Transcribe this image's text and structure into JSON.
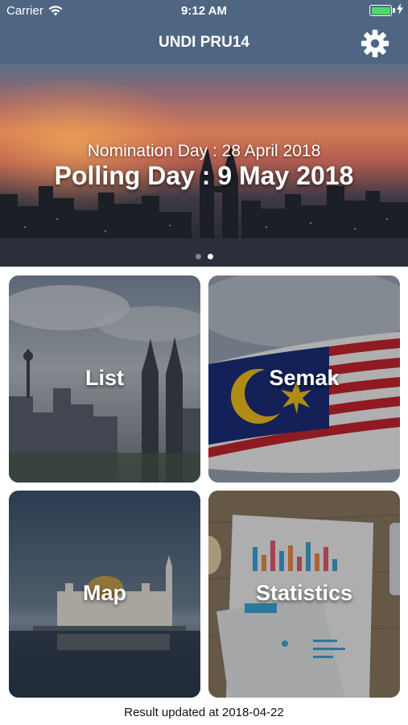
{
  "status_bar": {
    "carrier": "Carrier",
    "time": "9:12 AM",
    "wifi_icon": "wifi-icon",
    "battery_icon": "battery-icon",
    "battery_level": 1.0,
    "charging_icon": "bolt-icon"
  },
  "nav": {
    "title": "UNDI PRU14",
    "settings_icon": "gear-icon"
  },
  "banner": {
    "subtitle": "Nomination Day : 28 April 2018",
    "title": "Polling Day : 9 May 2018",
    "page_count": 2,
    "active_page": 2
  },
  "tiles": [
    {
      "label": "List"
    },
    {
      "label": "Semak"
    },
    {
      "label": "Map"
    },
    {
      "label": "Statistics"
    }
  ],
  "footer": {
    "text": "Result updated at 2018-04-22"
  },
  "colors": {
    "bar": "#4f6683",
    "battery": "#4cd964"
  }
}
